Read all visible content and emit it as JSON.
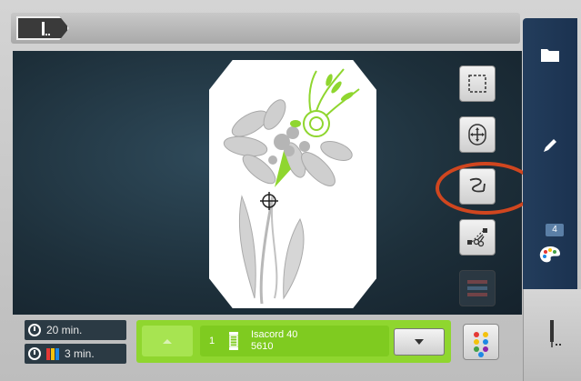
{
  "top_bar": {
    "breadcrumb_icon": "needle-pen-icon"
  },
  "workspace": {
    "tools": [
      {
        "id": "select",
        "icon": "dashed-selection-icon"
      },
      {
        "id": "move",
        "icon": "move-crosshair-icon"
      },
      {
        "id": "stitch_path",
        "icon": "stitch-path-icon"
      },
      {
        "id": "cut",
        "icon": "scissors-jump-icon"
      },
      {
        "id": "colors_disabled",
        "icon": "color-blocks-icon"
      }
    ]
  },
  "sidebar": {
    "items": [
      {
        "id": "folder",
        "icon": "folder-icon"
      },
      {
        "id": "edit",
        "icon": "pencil-icon"
      },
      {
        "id": "color",
        "icon": "palette-icon",
        "badge": "4"
      },
      {
        "id": "embroider",
        "icon": "needle-icon"
      }
    ]
  },
  "status": {
    "total_time": "20 min.",
    "color_time": "3 min.",
    "color_bars": [
      "#e53935",
      "#f4c20d",
      "#1e88e5"
    ]
  },
  "thread": {
    "number": "1",
    "name": "Isacord 40",
    "code": "5610",
    "color": "#8fd62f"
  },
  "palette_button": {
    "icon": "color-dots-icon"
  }
}
